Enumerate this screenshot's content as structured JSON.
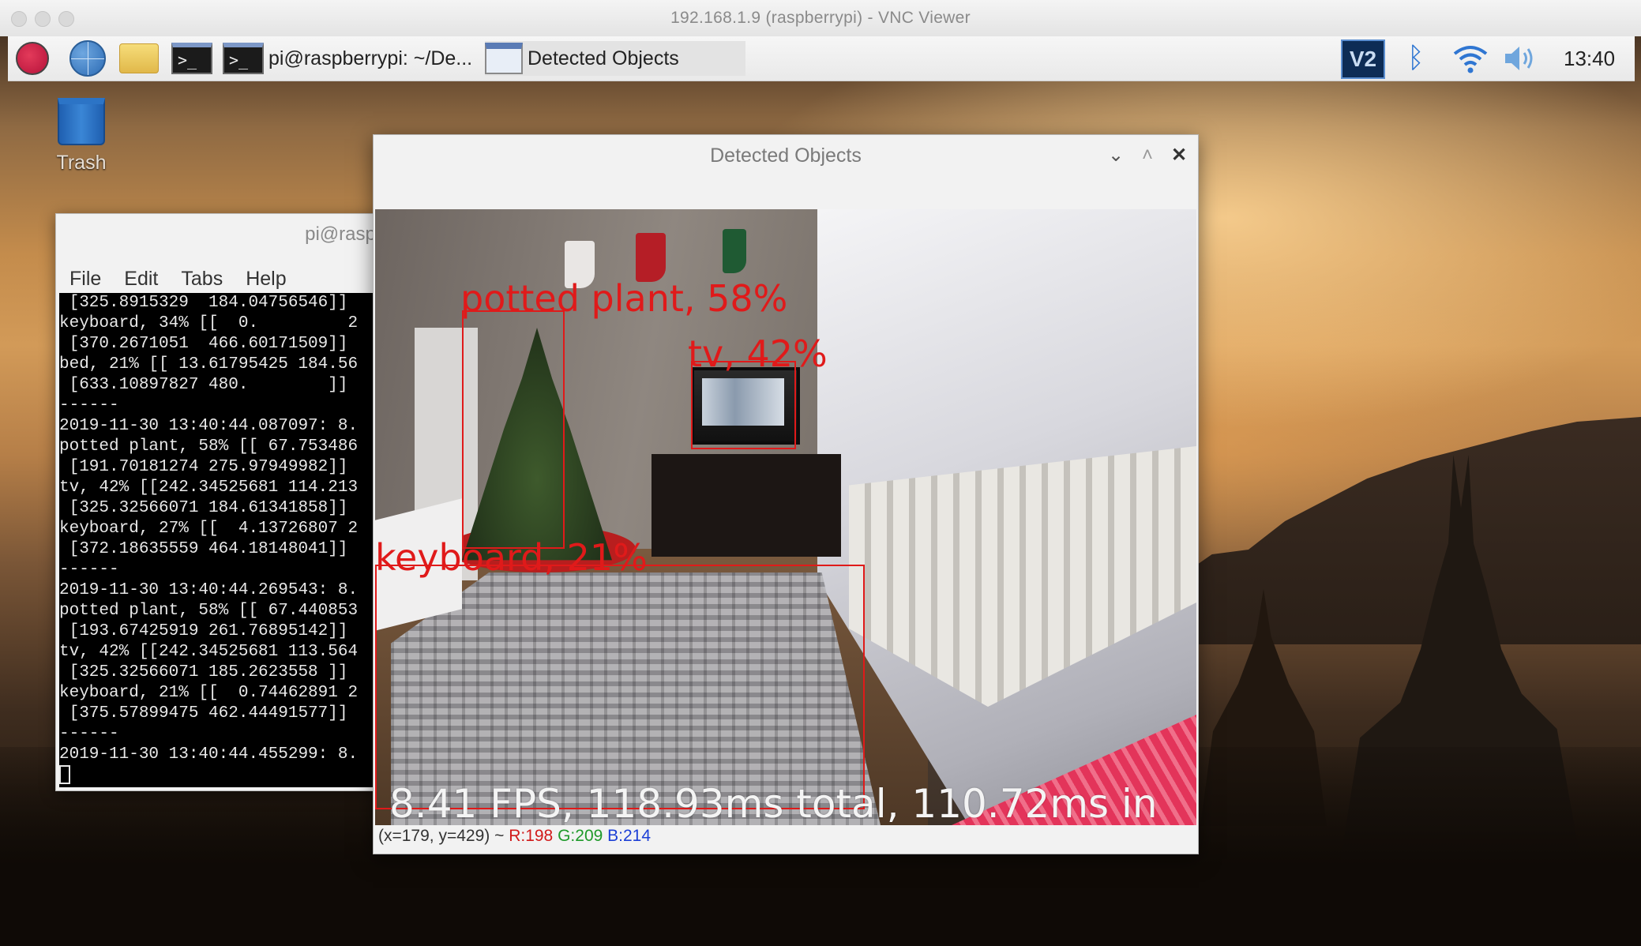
{
  "vnc": {
    "title": "192.168.1.9 (raspberrypi) - VNC Viewer"
  },
  "taskbar": {
    "launcher_icons": [
      "raspberry-menu-icon",
      "web-browser-globe-icon",
      "file-manager-folder-icon",
      "terminal-icon"
    ],
    "terminal_task_label": "pi@raspberrypi: ~/De...",
    "detect_task_label": "Detected Objects",
    "tray": {
      "vnc_icon_text": "V2",
      "clock": "13:40"
    }
  },
  "desktop": {
    "trash_label": "Trash"
  },
  "terminal": {
    "title": "pi@rasp",
    "menu": [
      "File",
      "Edit",
      "Tabs",
      "Help"
    ],
    "lines": [
      " [325.8915329  184.04756546]] ",
      "keyboard, 34% [[  0.         2",
      " [370.2671051  466.60171509]] ",
      "bed, 21% [[ 13.61795425 184.56",
      " [633.10897827 480.        ]] ",
      "------",
      "2019-11-30 13:40:44.087097: 8.",
      "potted plant, 58% [[ 67.753486",
      " [191.70181274 275.97949982]] ",
      "tv, 42% [[242.34525681 114.213",
      " [325.32566071 184.61341858]] ",
      "keyboard, 27% [[  4.13726807 2",
      " [372.18635559 464.18148041]] ",
      "------",
      "2019-11-30 13:40:44.269543: 8.",
      "potted plant, 58% [[ 67.440853",
      " [193.67425919 261.76895142]] ",
      "tv, 42% [[242.34525681 113.564",
      " [325.32566071 185.2623558 ]] ",
      "keyboard, 21% [[  0.74462891 2",
      " [375.57899475 462.44491577]] ",
      "------",
      "2019-11-30 13:40:44.455299: 8."
    ]
  },
  "detect_window": {
    "title": "Detected Objects",
    "detections": [
      {
        "label": "potted plant, 58%"
      },
      {
        "label": "tv, 42%"
      },
      {
        "label": "keyboard, 21%"
      }
    ],
    "overlay_text": "8.41 FPS, 118.93ms total, 110.72ms in",
    "status": {
      "coords": "(x=179, y=429) ~",
      "r": "R:198",
      "g": "G:209",
      "b": "B:214"
    }
  },
  "colors": {
    "detection_box": "#e01a1a",
    "taskbar_bg": "#f2f2f2",
    "terminal_bg": "#000000"
  }
}
